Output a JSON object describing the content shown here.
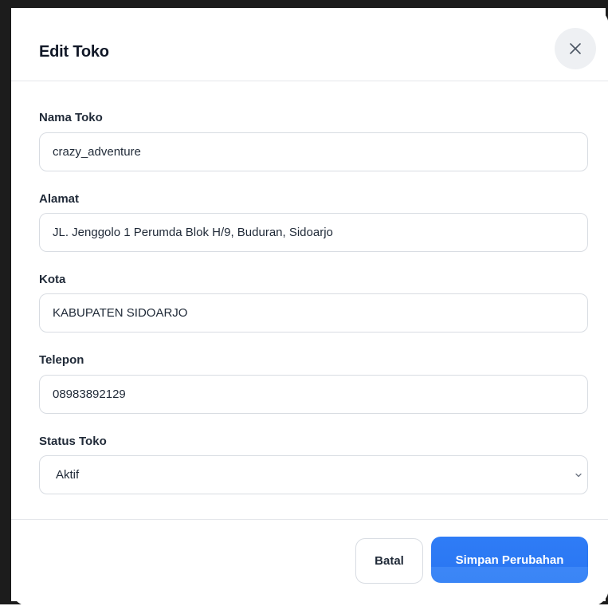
{
  "modal": {
    "title": "Edit Toko",
    "close_icon": "close-icon"
  },
  "fields": {
    "nama_toko": {
      "label": "Nama Toko",
      "value": "crazy_adventure"
    },
    "alamat": {
      "label": "Alamat",
      "value": "JL. Jenggolo 1 Perumda Blok H/9, Buduran, Sidoarjo"
    },
    "kota": {
      "label": "Kota",
      "value": "KABUPATEN SIDOARJO"
    },
    "telepon": {
      "label": "Telepon",
      "value": "08983892129"
    },
    "status_toko": {
      "label": "Status Toko",
      "selected": "Aktif",
      "icon": "chevron-down-icon"
    }
  },
  "footer": {
    "cancel_label": "Batal",
    "save_label": "Simpan Perubahan"
  },
  "colors": {
    "primary": "#2f7cf6",
    "border": "#d8dce2",
    "close_bg": "#eef0f3",
    "text": "#1f2937"
  }
}
